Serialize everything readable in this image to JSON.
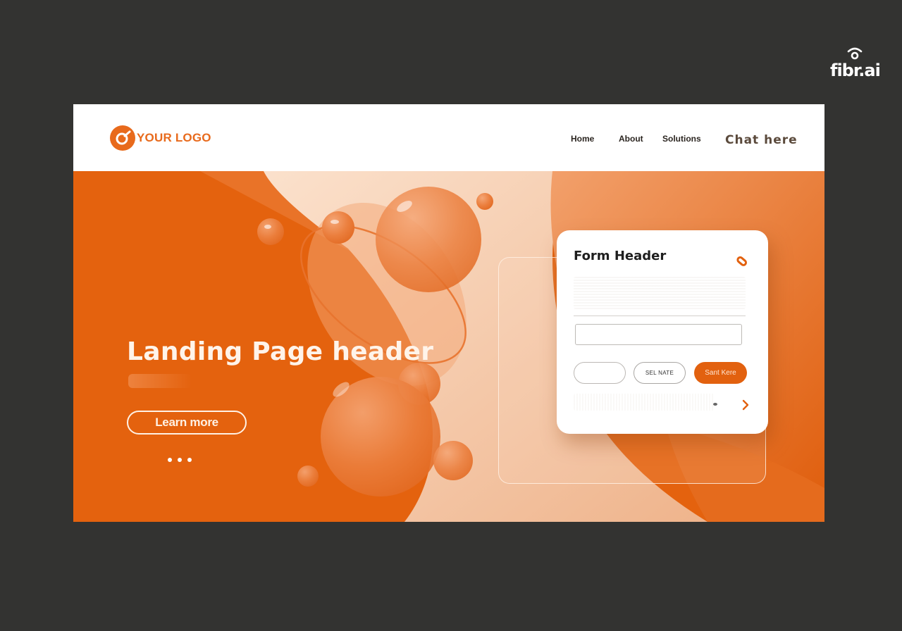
{
  "brand": {
    "name": "fibr.ai",
    "icon": "wifi-signal-icon"
  },
  "colors": {
    "accent": "#e86a1c",
    "hero_orange": "#e9640f",
    "peach": "#f6c9a6",
    "backdrop": "#333331",
    "button_fill": "#e2610f"
  },
  "navbar": {
    "logo_text": "YOUR LOGO",
    "logo_icon": "logo-ring-icon",
    "links": [
      {
        "label": "Home"
      },
      {
        "label": "About"
      },
      {
        "label": "Solutions"
      }
    ],
    "cta_label": "Chat here"
  },
  "hero": {
    "title": "Landing Page header",
    "button_label": "Learn more",
    "carousel": {
      "count": 3
    }
  },
  "form": {
    "title": "Form Header",
    "header_icon": "tag-icon",
    "input_value": "",
    "input_placeholder": "",
    "buttons": [
      {
        "label": ""
      },
      {
        "label": "SEL NATE"
      },
      {
        "label": "Sant Kere"
      }
    ],
    "next_icon": "chevron-right-icon"
  }
}
